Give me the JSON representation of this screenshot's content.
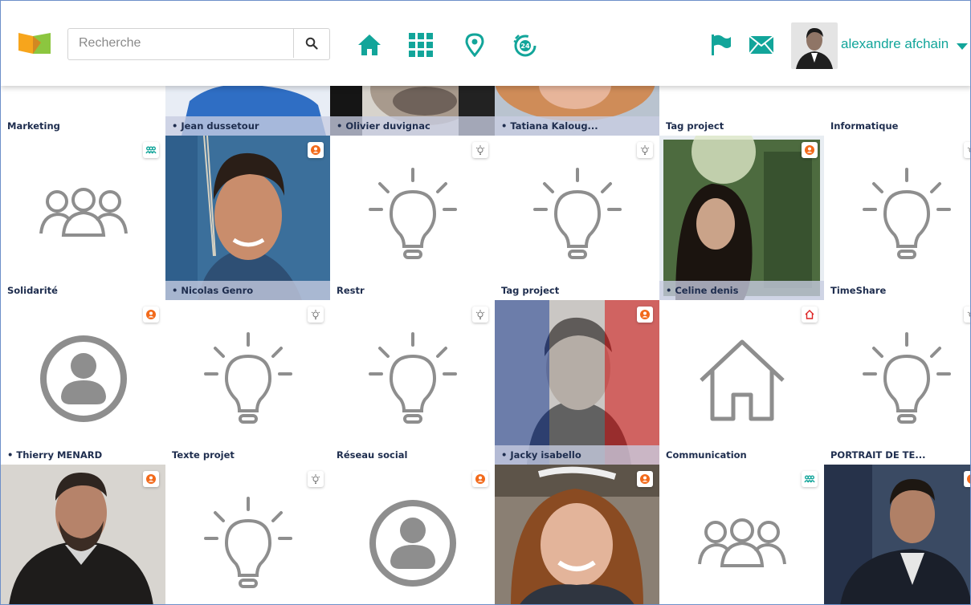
{
  "search": {
    "placeholder": "Recherche"
  },
  "user": {
    "name": "alexandre afchain"
  },
  "colors": {
    "teal": "#12a59a",
    "orange": "#f26a1b",
    "navy": "#1e2d4e",
    "gray_icon": "#8e8e8e"
  },
  "nav": {
    "icons": [
      "home-icon",
      "apps-grid-icon",
      "location-pin-icon",
      "24h-icon",
      "flag-icon",
      "mail-icon",
      "chevron-down-icon"
    ]
  },
  "grid": {
    "top_row_labels": {
      "c0": "Marketing",
      "c1": "• Jean dussetour",
      "c2": "• Olivier duvignac",
      "c3": "• Tatiana Kaloug...",
      "c4": "Tag project",
      "c5": "Informatique"
    },
    "row1": {
      "c0": "Solidarité",
      "c1": "• Nicolas Genro",
      "c2": "Restr",
      "c3": "Tag project",
      "c4": "• Celine denis",
      "c5": "TimeShare"
    },
    "row2": {
      "c0": "• Thierry MENARD",
      "c1": "Texte projet",
      "c2": "Réseau social",
      "c3": "• Jacky isabello",
      "c4": "Communication",
      "c5": "PORTRAIT DE TE..."
    }
  }
}
